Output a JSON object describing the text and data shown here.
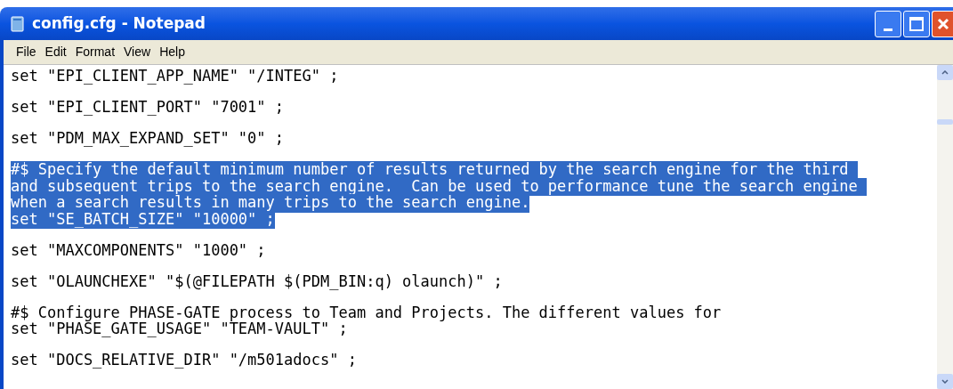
{
  "window": {
    "title": "config.cfg - Notepad"
  },
  "menu": [
    "File",
    "Edit",
    "Format",
    "View",
    "Help"
  ],
  "blocks": [
    [
      {
        "text": "set \"EPI_CLIENT_APP_NAME\" \"/INTEG\" ;",
        "selected": false
      }
    ],
    [
      {
        "text": "set \"EPI_CLIENT_PORT\" \"7001\" ;",
        "selected": false
      }
    ],
    [
      {
        "text": "set \"PDM_MAX_EXPAND_SET\" \"0\" ;",
        "selected": false
      }
    ],
    [
      {
        "text": "#$ Specify the default minimum number of results returned by the search engine for the third ",
        "selected": true
      },
      {
        "text": "and subsequent trips to the search engine.  Can be used to performance tune the search engine ",
        "selected": true
      },
      {
        "text": "when a search results in many trips to the search engine.",
        "selected": true
      },
      {
        "text": "set \"SE_BATCH_SIZE\" \"10000\" ;",
        "selected": true
      }
    ],
    [
      {
        "text": "set \"MAXCOMPONENTS\" \"1000\" ;",
        "selected": false
      }
    ],
    [
      {
        "text": "set \"OLAUNCHEXE\" \"$(@FILEPATH $(PDM_BIN:q) olaunch)\" ;",
        "selected": false
      }
    ],
    [
      {
        "text": "#$ Configure PHASE-GATE process to Team and Projects. The different values for",
        "selected": false
      },
      {
        "text": "set \"PHASE_GATE_USAGE\" \"TEAM-VAULT\" ;",
        "selected": false
      }
    ],
    [
      {
        "text": "set \"DOCS_RELATIVE_DIR\" \"/m501adocs\" ;",
        "selected": false
      }
    ]
  ]
}
